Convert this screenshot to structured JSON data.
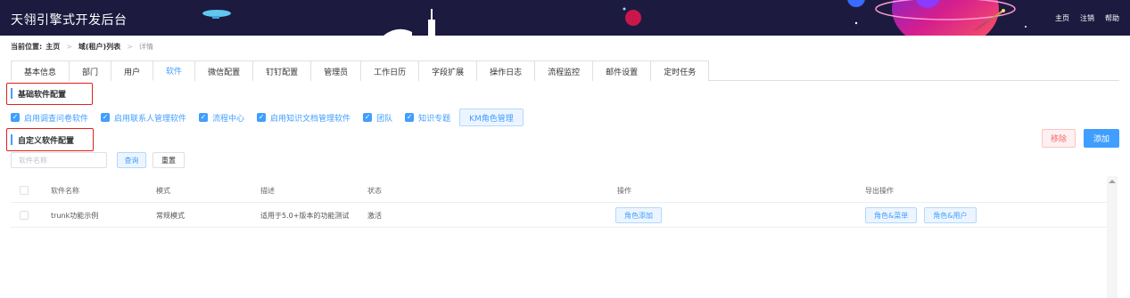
{
  "header": {
    "app_title": "天翎引擎式开发后台",
    "links": [
      "主页",
      "注销",
      "帮助"
    ]
  },
  "breadcrumb": {
    "label": "当前位置:",
    "items": [
      "主页",
      "域(租户)列表",
      "详情"
    ]
  },
  "tabs": [
    "基本信息",
    "部门",
    "用户",
    "软件",
    "微信配置",
    "钉钉配置",
    "管理员",
    "工作日历",
    "字段扩展",
    "操作日志",
    "流程监控",
    "邮件设置",
    "定时任务"
  ],
  "active_tab": "软件",
  "basic_section": {
    "title": "基础软件配置",
    "checkboxes": [
      {
        "label": "启用调查问卷软件",
        "checked": true
      },
      {
        "label": "启用联系人管理软件",
        "checked": true
      },
      {
        "label": "流程中心",
        "checked": true
      },
      {
        "label": "启用知识文档管理软件",
        "checked": true
      },
      {
        "label": "团队",
        "checked": true
      },
      {
        "label": "知识专题",
        "checked": true
      }
    ],
    "km_button": "KM角色管理"
  },
  "custom_section": {
    "title": "自定义软件配置",
    "remove_label": "移除",
    "add_label": "添加",
    "search_placeholder": "软件名称",
    "query_label": "查询",
    "reset_label": "重置"
  },
  "table": {
    "columns": [
      "软件名称",
      "模式",
      "描述",
      "状态",
      "操作",
      "导出操作"
    ],
    "rows": [
      {
        "name": "trunk功能示例",
        "mode": "常规模式",
        "desc": "适用于5.0+版本的功能测试",
        "status": "激活",
        "action": "角色添加",
        "export_actions": [
          "角色&菜单",
          "角色&用户"
        ]
      }
    ]
  },
  "colors": {
    "header_bg": "#1d1a3f",
    "accent": "#409eff",
    "danger": "#f56c6c",
    "highlight_box": "#e0201c"
  }
}
